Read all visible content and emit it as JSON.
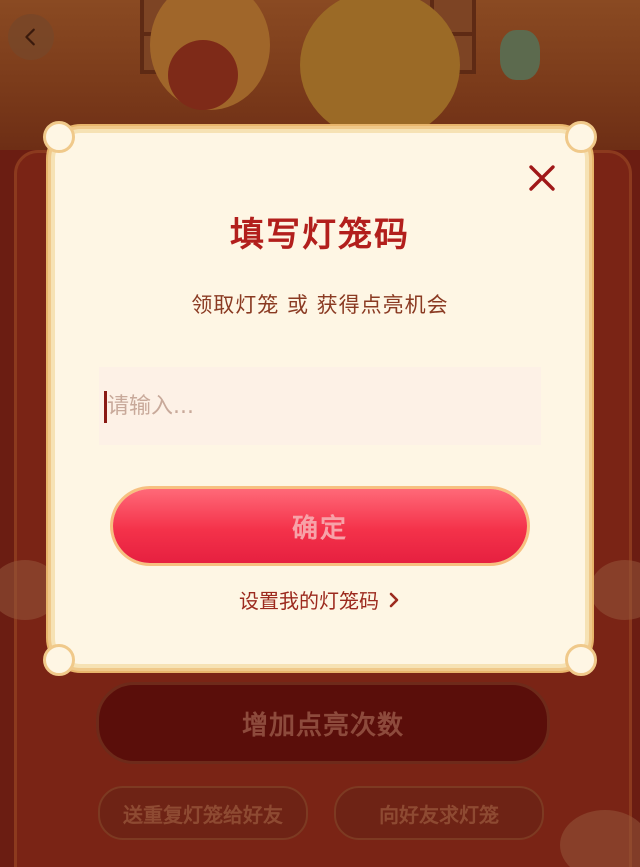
{
  "background": {
    "primary_button_label": "增加点亮次数",
    "secondary_buttons": [
      {
        "label": "送重复灯笼给好友"
      },
      {
        "label": "向好友求灯笼"
      }
    ]
  },
  "modal": {
    "title": "填写灯笼码",
    "subtitle": "领取灯笼 或 获得点亮机会",
    "input": {
      "placeholder": "请输入...",
      "value": ""
    },
    "confirm_label": "确定",
    "set_code_link_label": "设置我的灯笼码"
  },
  "icons": {
    "back": "chevron-left-icon",
    "close": "close-icon",
    "link_arrow": "chevron-right-icon"
  },
  "colors": {
    "title": "#b21f1c",
    "confirm_button": "#f4324a",
    "modal_background": "#fef6e4"
  }
}
